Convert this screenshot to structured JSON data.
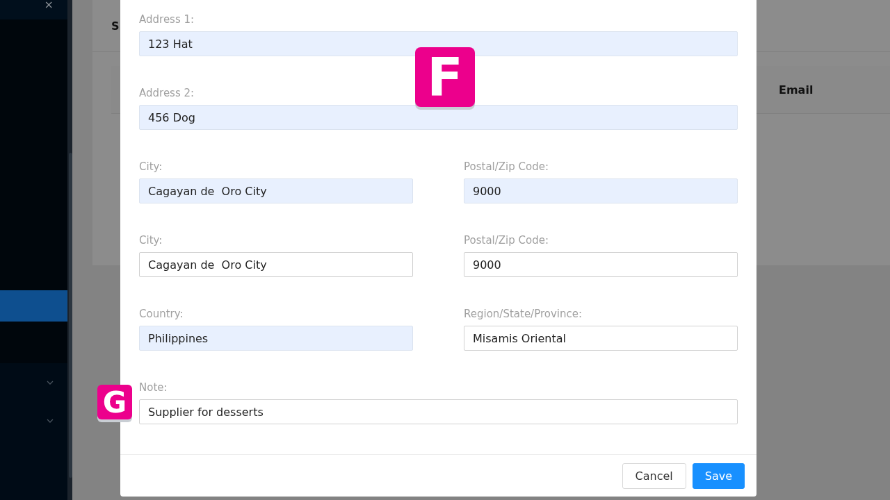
{
  "sidebar": {
    "close_icon": "×",
    "items": [
      {
        "kind": "plain",
        "selected": true
      },
      {
        "kind": "group",
        "selected": false,
        "expanded": false
      },
      {
        "kind": "group",
        "selected": false,
        "expanded": false
      }
    ]
  },
  "background": {
    "card_title": "S",
    "columns": [
      "Email"
    ]
  },
  "form": {
    "rows": [
      [
        {
          "label": "Address 1:",
          "value": "123 Hat",
          "autofilled": true
        }
      ],
      [
        {
          "label": "Address 2:",
          "value": "456 Dog",
          "autofilled": true
        }
      ],
      [
        {
          "label": "City:",
          "value": "Cagayan de  Oro City",
          "autofilled": true
        },
        {
          "label": "Postal/Zip Code:",
          "value": "9000",
          "autofilled": true
        }
      ],
      [
        {
          "label": "City:",
          "value": "Cagayan de  Oro City",
          "autofilled": false
        },
        {
          "label": "Postal/Zip Code:",
          "value": "9000",
          "autofilled": false
        }
      ],
      [
        {
          "label": "Country:",
          "value": "Philippines",
          "autofilled": true
        },
        {
          "label": "Region/State/Province:",
          "value": "Misamis Oriental",
          "autofilled": false
        }
      ],
      [
        {
          "label": "Note:",
          "value": "Supplier for desserts",
          "autofilled": false
        }
      ]
    ],
    "buttons": [
      {
        "label": "Cancel",
        "kind": "default"
      },
      {
        "label": "Save",
        "kind": "primary"
      }
    ]
  },
  "callouts": [
    {
      "letter": "F"
    },
    {
      "letter": "G"
    }
  ]
}
